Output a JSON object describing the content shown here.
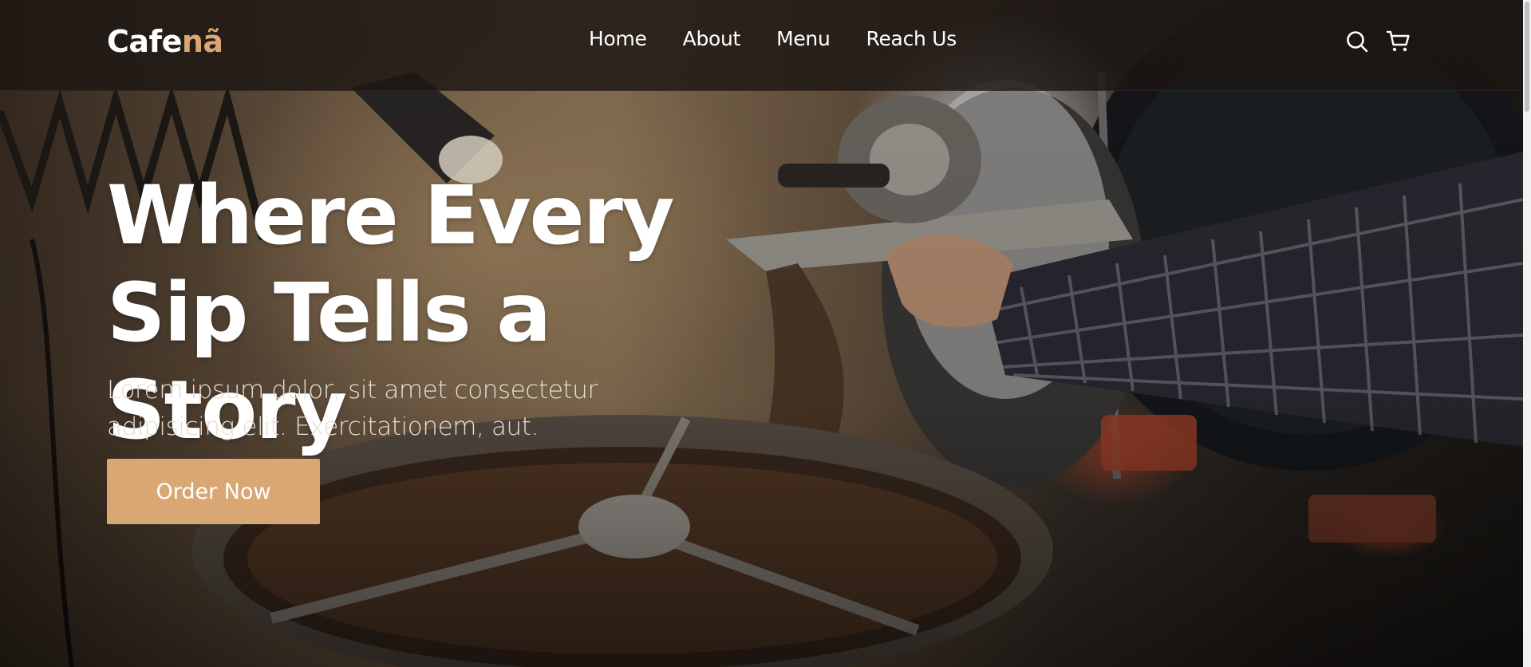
{
  "brand": {
    "name_main": "Cafe",
    "name_accent": "nã",
    "accent_color": "#d9a774"
  },
  "nav": {
    "items": [
      {
        "label": "Home"
      },
      {
        "label": "About"
      },
      {
        "label": "Menu"
      },
      {
        "label": "Reach Us"
      }
    ]
  },
  "header_icons": [
    {
      "icon": "search-icon"
    },
    {
      "icon": "cart-icon"
    }
  ],
  "hero": {
    "title": "Where Every Sip Tells a Story",
    "subtitle": "Lorem ipsum dolor, sit amet consectetur adipisicing elit. Exercitationem, aut.",
    "cta_label": "Order Now",
    "cta_color": "#d9a774"
  }
}
